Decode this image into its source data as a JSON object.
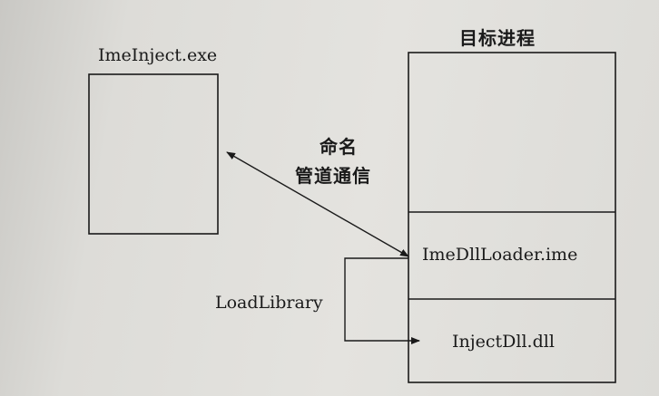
{
  "diagram": {
    "injector": {
      "title": "ImeInject.exe"
    },
    "target_process": {
      "title": "目标进程",
      "modules": [
        {
          "label": "ImeDllLoader.ime"
        },
        {
          "label": "InjectDll.dll"
        }
      ]
    },
    "channel": {
      "label_line1": "命名",
      "label_line2": "管道通信"
    },
    "load_call": {
      "label": "LoadLibrary"
    }
  }
}
